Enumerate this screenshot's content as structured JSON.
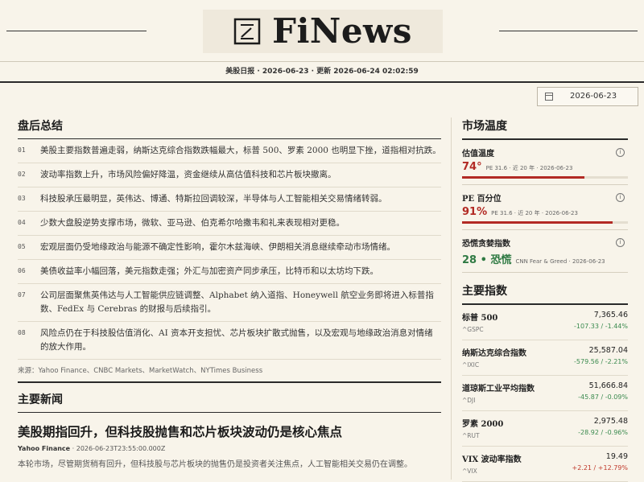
{
  "masthead": {
    "title": "FiNews",
    "logo_icon": "edit-frame-icon"
  },
  "dateline": "美股日报 · 2026-06-23 · 更新 2026-06-24 02:02:59",
  "datepicker": {
    "value": "2026-06-23",
    "icon": "calendar-icon"
  },
  "summary": {
    "title": "盘后总结",
    "items": [
      {
        "num": "01",
        "text": "美股主要指数普遍走弱，纳斯达克综合指数跌幅最大，标普 500、罗素 2000 也明显下挫，道指相对抗跌。"
      },
      {
        "num": "02",
        "text": "波动率指数上升，市场风险偏好降温，资金继续从高估值科技和芯片板块撤离。"
      },
      {
        "num": "03",
        "text": "科技股承压最明显，英伟达、博通、特斯拉回调较深，半导体与人工智能相关交易情绪转弱。"
      },
      {
        "num": "04",
        "text": "少数大盘股逆势支撑市场，微软、亚马逊、伯克希尔哈撒韦和礼来表现相对更稳。"
      },
      {
        "num": "05",
        "text": "宏观层面仍受地缘政治与能源不确定性影响，霍尔木兹海峡、伊朗相关消息继续牵动市场情绪。"
      },
      {
        "num": "06",
        "text": "美债收益率小幅回落，美元指数走强；外汇与加密资产同步承压，比特币和以太坊均下跌。"
      },
      {
        "num": "07",
        "text": "公司层面聚焦英伟达与人工智能供应链调整、Alphabet 纳入道指、Honeywell 航空业务即将进入标普指数、FedEx 与 Cerebras 的财报与后续指引。"
      },
      {
        "num": "08",
        "text": "风险点仍在于科技股估值消化、AI 资本开支担忧、芯片板块扩散式抛售，以及宏观与地缘政治消息对情绪的放大作用。"
      }
    ],
    "sources": "来源：Yahoo Finance、CNBC Markets、MarketWatch、NYTimes Business"
  },
  "news": {
    "title": "主要新闻",
    "headline": "美股期指回升，但科技股抛售和芯片板块波动仍是核心焦点",
    "source": "Yahoo Finance",
    "time": "· 2026-06-23T23:55:00.000Z",
    "teaser": "本轮市场，尽管期货稍有回升，但科技股与芯片板块的抛售仍是投资者关注焦点，人工智能相关交易仍在调整。"
  },
  "temperature": {
    "title": "市场温度",
    "metrics": [
      {
        "label": "估值温度",
        "value": "74°",
        "sub": "PE 31.6 · 近 20 年 · 2026-06-23",
        "color": "#b22a24",
        "level": 0.74
      },
      {
        "label": "PE 百分位",
        "value": "91%",
        "sub": "PE 31.6 · 近 20 年 · 2026-06-23",
        "color": "#b22a24",
        "level": 0.91
      },
      {
        "label": "恐慌贪婪指数",
        "value": "28 • 恐慌",
        "sub": "CNN Fear & Greed · 2026-06-23",
        "color": "#2f7a43"
      }
    ]
  },
  "indices": {
    "title": "主要指数",
    "rows": [
      {
        "name": "标普 500",
        "sym": "^GSPC",
        "price": "7,365.46",
        "chg": "-107.33 / -1.44%",
        "dir": "dn"
      },
      {
        "name": "纳斯达克综合指数",
        "sym": "^IXIC",
        "price": "25,587.04",
        "chg": "-579.56 / -2.21%",
        "dir": "dn"
      },
      {
        "name": "道琼斯工业平均指数",
        "sym": "^DJI",
        "price": "51,666.84",
        "chg": "-45.87 / -0.09%",
        "dir": "dn"
      },
      {
        "name": "罗素 2000",
        "sym": "^RUT",
        "price": "2,975.48",
        "chg": "-28.92 / -0.96%",
        "dir": "dn"
      },
      {
        "name": "VIX 波动率指数",
        "sym": "^VIX",
        "price": "19.49",
        "chg": "+2.21 / +12.79%",
        "dir": "up"
      }
    ]
  }
}
